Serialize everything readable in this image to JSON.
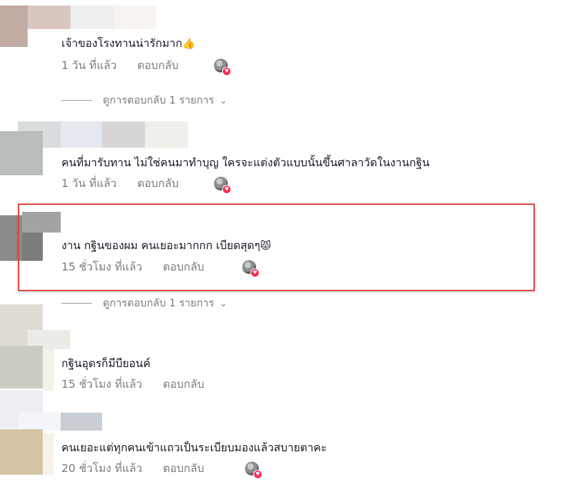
{
  "comments": [
    {
      "text": "เจ้าของโรงทานน่ารักมาก",
      "emoji": "👍",
      "time": "1 วัน ที่แล้ว",
      "reply": "ตอบกลับ",
      "view_replies": "ดูการตอบกลับ 1 รายการ"
    },
    {
      "text": "คนที่มารับทาน ไม่ใช่คนมาทำบุญ ใครจะแต่งตัวแบบนั้นขึ้นศาลาวัดในงานกฐิน",
      "time": "1 วัน ที่แล้ว",
      "reply": "ตอบกลับ"
    },
    {
      "text": "งาน กฐินของผม คนเยอะมากกก เบียดสุดๆ",
      "emoji": "😾",
      "time": "15 ชั่วโมง ที่แล้ว",
      "reply": "ตอบกลับ",
      "view_replies": "ดูการตอบกลับ 1 รายการ"
    },
    {
      "text": "กฐินอุดรก็มีบียอนค์",
      "time": "15 ชั่วโมง ที่แล้ว",
      "reply": "ตอบกลับ"
    },
    {
      "text": "คนเยอะแต่ทุกคนเข้าแถวเป็นระเบียบมองแล้วสบายตาคะ",
      "time": "20 ชั่วโมง ที่แล้ว",
      "reply": "ตอบกลับ"
    }
  ],
  "icons": {
    "chevron": "chevron-down-icon",
    "liked_by_creator": "heart-icon"
  },
  "colors": {
    "text": "#161823",
    "meta": "#7a7b80",
    "highlight": "#e2443f",
    "heart": "#fe2c55"
  }
}
